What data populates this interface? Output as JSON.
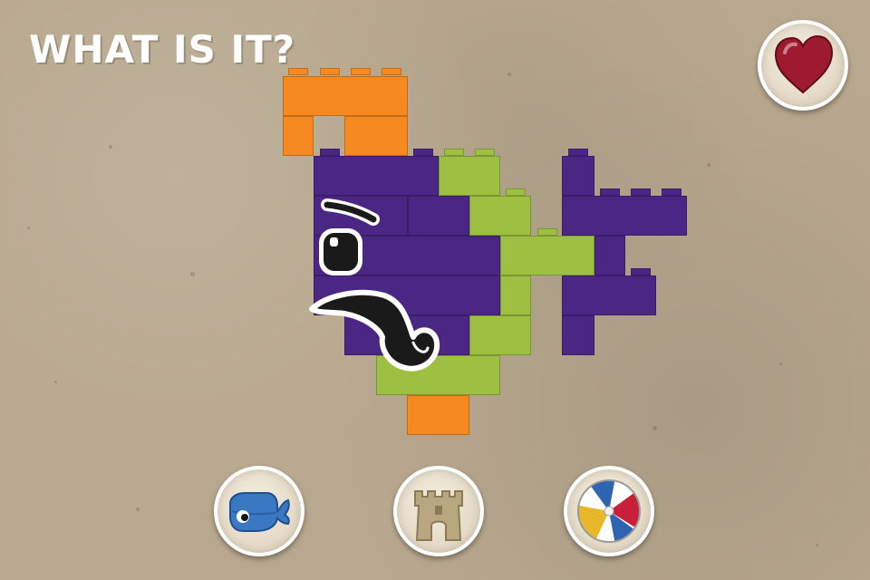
{
  "header": {
    "title": "WHAT IS IT?"
  },
  "favorite_button": {
    "icon": "heart-icon",
    "color": "#9e1a2e"
  },
  "answer_choices": [
    {
      "id": "whale",
      "icon": "whale-icon",
      "color": "#3a78c4"
    },
    {
      "id": "sandcastle",
      "icon": "sandcastle-icon",
      "color": "#b9a77f"
    },
    {
      "id": "beach-ball",
      "icon": "beach-ball-icon",
      "colors": [
        "#c8203a",
        "#2f65b0",
        "#e8b82a",
        "#ffffff"
      ]
    }
  ],
  "puzzle": {
    "colors": {
      "purple": "#4a2785",
      "green": "#9dc043",
      "orange": "#f68a21"
    },
    "features": [
      "eye-icon",
      "eyebrow-icon",
      "mustache-icon"
    ]
  }
}
